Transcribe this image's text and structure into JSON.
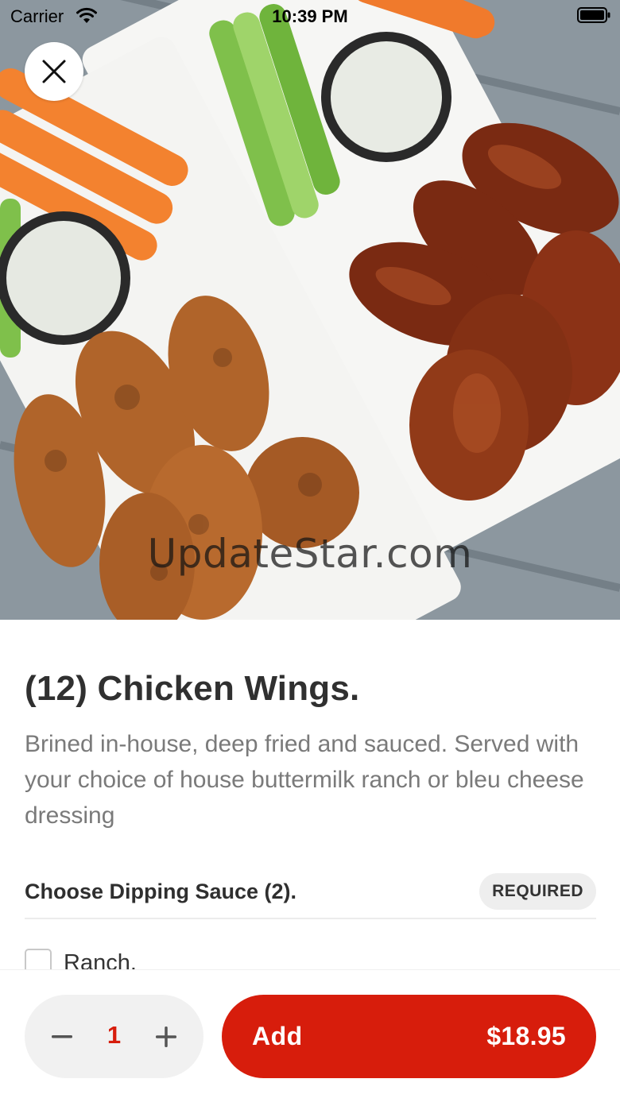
{
  "status_bar": {
    "carrier": "Carrier",
    "time": "10:39 PM"
  },
  "hero": {
    "image_subject": "chicken wings with celery, carrots and ranch dressing",
    "watermark": "UpdateStar.com"
  },
  "close_button": {
    "icon": "close-icon"
  },
  "item": {
    "title": "(12) Chicken Wings.",
    "description": "Brined in-house, deep fried and sauced. Served with your choice of house buttermilk ranch or bleu cheese dressing"
  },
  "options_section": {
    "title": "Choose Dipping Sauce (2).",
    "badge": "REQUIRED",
    "options": [
      {
        "label": "Ranch.",
        "checked": false
      }
    ]
  },
  "footer": {
    "quantity": "1",
    "minus_icon": "minus-icon",
    "plus_icon": "plus-icon",
    "add_label": "Add",
    "price": "$18.95"
  },
  "colors": {
    "accent": "#d71d0c",
    "stepper_bg": "#f1f1f1",
    "badge_bg": "#eeeeee",
    "description_text": "#7a7a7a"
  }
}
